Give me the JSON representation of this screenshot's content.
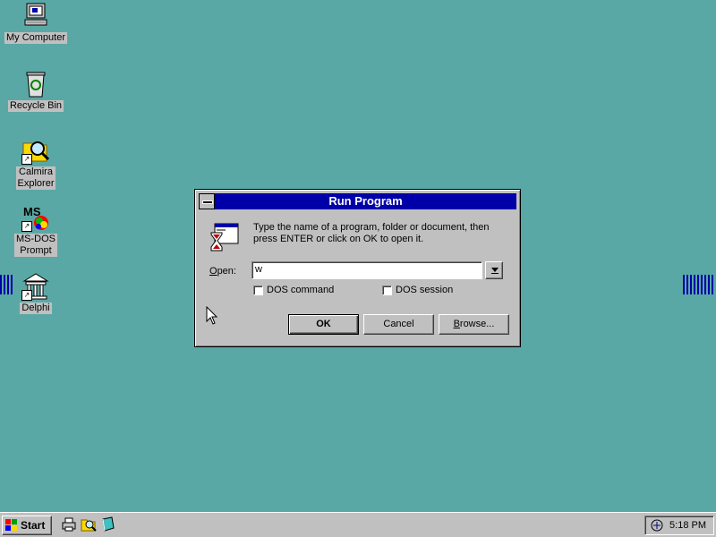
{
  "desktop": {
    "icons": [
      {
        "label": "My Computer",
        "icon": "computer-icon"
      },
      {
        "label": "Recycle Bin",
        "icon": "recycle-bin-icon"
      },
      {
        "label": "Calmira\nExplorer",
        "icon": "folder-search-icon"
      },
      {
        "label": "MS-DOS\nPrompt",
        "icon": "msdos-icon"
      },
      {
        "label": "Delphi",
        "icon": "delphi-icon"
      }
    ]
  },
  "dialog": {
    "title": "Run Program",
    "message": "Type the name of a program, folder or document, then press ENTER or click on OK to open it.",
    "open_label": "Open:",
    "open_value": "w",
    "dos_command_label": "DOS command",
    "dos_session_label": "DOS session",
    "ok_label": "OK",
    "cancel_label": "Cancel",
    "browse_label": "Browse..."
  },
  "taskbar": {
    "start_label": "Start",
    "clock": "5:18 PM",
    "quick_launch": [
      "printer-icon",
      "magnifier-folder-icon",
      "book-icon"
    ]
  },
  "colors": {
    "desktop": "#5aa8a6",
    "titlebar": "#0000a8",
    "face": "#c0c0c0"
  }
}
